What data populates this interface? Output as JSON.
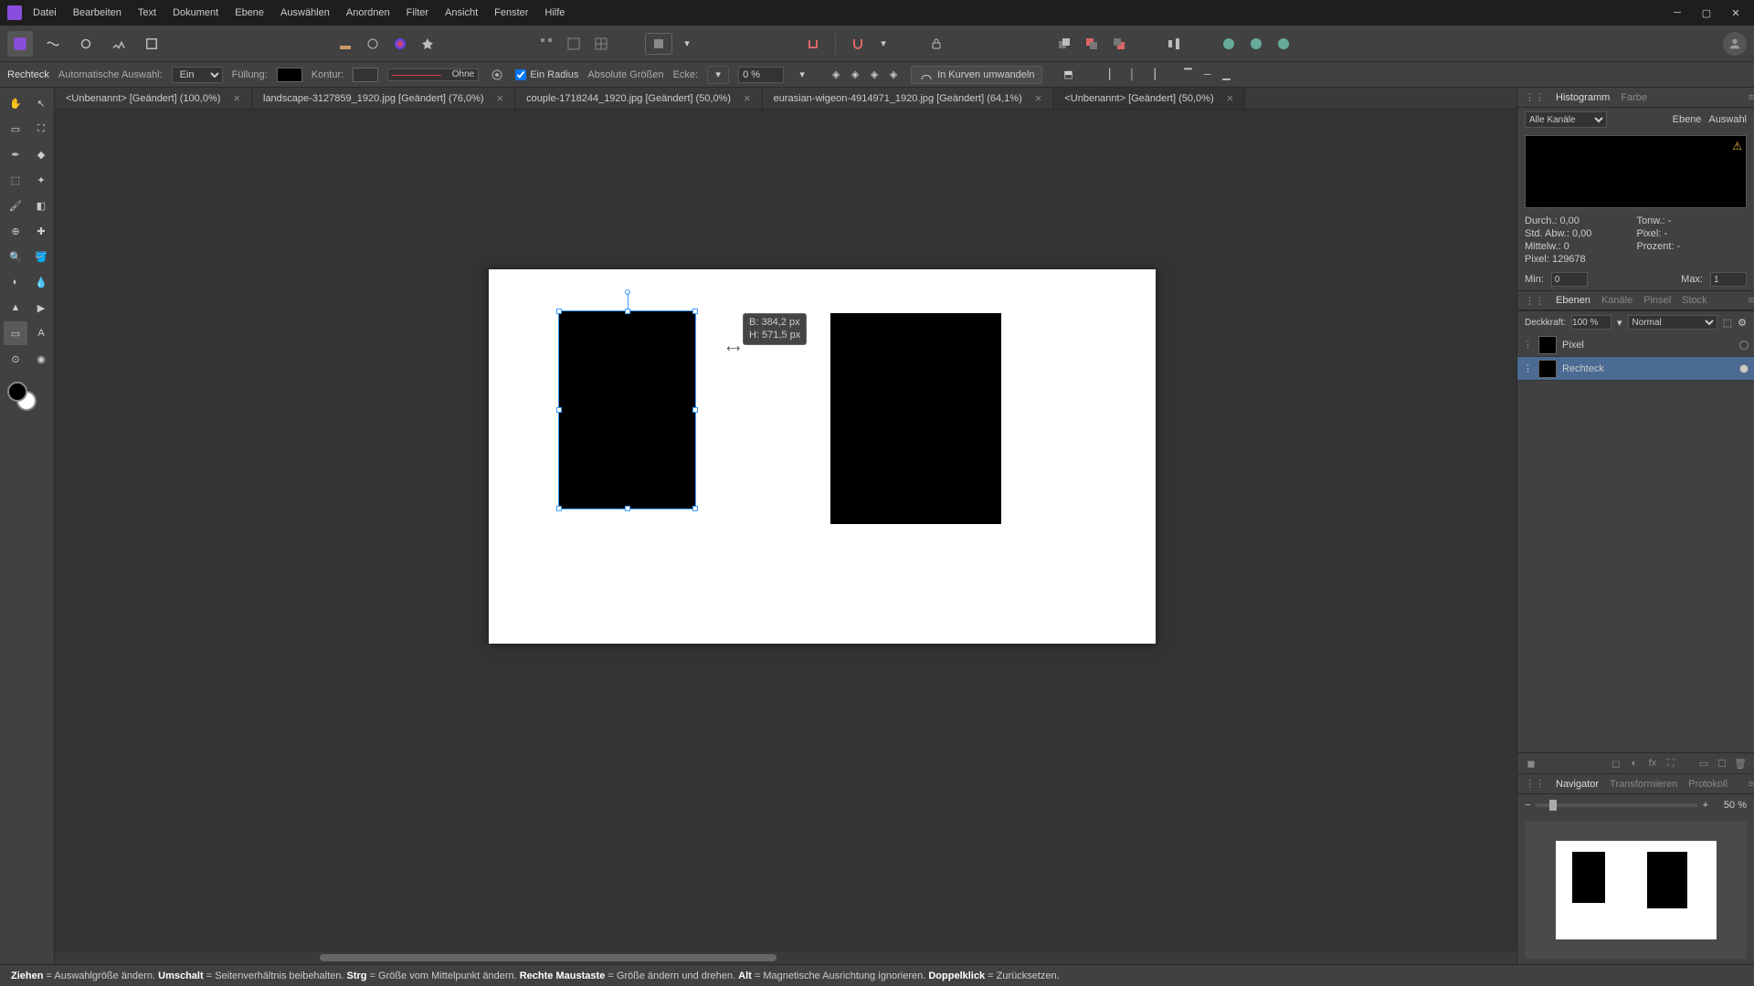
{
  "menu": {
    "items": [
      "Datei",
      "Bearbeiten",
      "Text",
      "Dokument",
      "Ebene",
      "Auswählen",
      "Anordnen",
      "Filter",
      "Ansicht",
      "Fenster",
      "Hilfe"
    ]
  },
  "context": {
    "tool": "Rechteck",
    "auto_select_label": "Automatische Auswahl:",
    "auto_select_value": "Ein",
    "fill_label": "Füllung:",
    "stroke_label": "Kontur:",
    "stroke_none": "Ohne",
    "radius_label": "Ein Radius",
    "abs_label": "Absolute Größen",
    "corner_label": "Ecke:",
    "corner_value": "0 %",
    "curves_label": "In Kurven umwandeln"
  },
  "tabs": [
    {
      "label": "<Unbenannt> [Geändert] (100,0%)",
      "active": false
    },
    {
      "label": "landscape-3127859_1920.jpg [Geändert] (76,0%)",
      "active": false
    },
    {
      "label": "couple-1718244_1920.jpg [Geändert] (50,0%)",
      "active": false
    },
    {
      "label": "eurasian-wigeon-4914971_1920.jpg [Geändert] (64,1%)",
      "active": false
    },
    {
      "label": "<Unbenannt> [Geändert] (50,0%)",
      "active": true
    }
  ],
  "dim_tip": {
    "w": "B: 384,2 px",
    "h": "H: 571,5 px"
  },
  "hist": {
    "tab1": "Histogramm",
    "tab2": "Farbe",
    "channel": "Alle Kanäle",
    "layer": "Ebene",
    "sel": "Auswahl",
    "stats": {
      "durch": "Durch.: 0,00",
      "std": "Std. Abw.: 0,00",
      "median": "Mittelw.: 0",
      "pixel": "Pixel: 129678",
      "tone": "Tonw.: -",
      "pix": "Pixel: -",
      "proz": "Prozent: -"
    },
    "min_lbl": "Min:",
    "min_val": "0",
    "max_lbl": "Max:",
    "max_val": "1"
  },
  "layers": {
    "tabs": [
      "Ebenen",
      "Kanäle",
      "Pinsel",
      "Stock"
    ],
    "opacity_lbl": "Deckkraft:",
    "opacity_val": "100 %",
    "blend": "Normal",
    "items": [
      {
        "name": "Pixel",
        "sel": false
      },
      {
        "name": "Rechteck",
        "sel": true
      }
    ]
  },
  "nav": {
    "tabs": [
      "Navigator",
      "Transformieren",
      "Protokoll"
    ],
    "zoom": "50 %"
  },
  "status": {
    "s1": "Ziehen",
    "t1": " = Auswahlgröße ändern. ",
    "s2": "Umschalt",
    "t2": " = Seitenverhältnis beibehalten. ",
    "s3": "Strg",
    "t3": " = Größe vom Mittelpunkt ändern. ",
    "s4": "Rechte Maustaste",
    "t4": " = Größe ändern und drehen. ",
    "s5": "Alt",
    "t5": " = Magnetische Ausrichtung ignorieren. ",
    "s6": "Doppelklick",
    "t6": " = Zurücksetzen."
  }
}
